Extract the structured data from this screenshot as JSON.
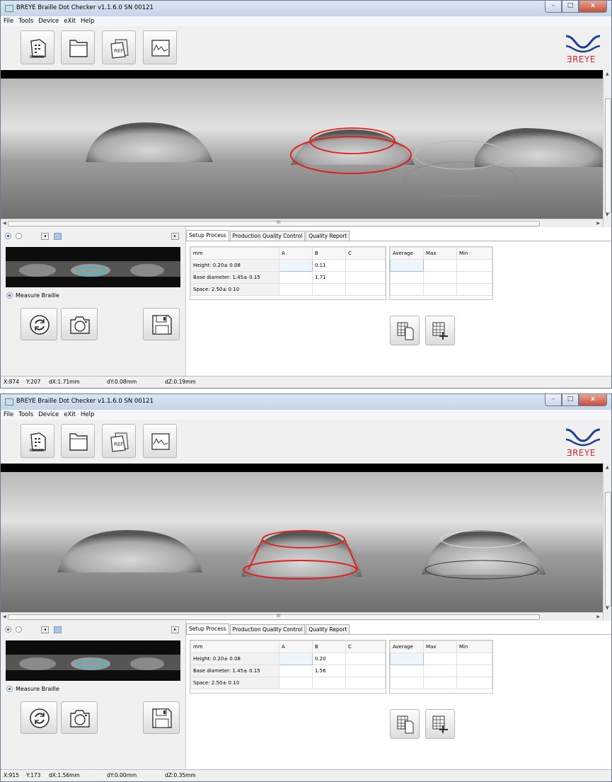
{
  "windows": [
    {
      "title": "BREYE Braille Dot Checker v1.1.6.0 SN 00121",
      "window_controls": {
        "minimize": "–",
        "maximize": "□",
        "close": "x"
      },
      "menu": [
        "File",
        "Tools",
        "Device",
        "eXit",
        "Help"
      ],
      "logo_text": "BREYE",
      "measure_label": "Measure Braille",
      "tabs": [
        "Setup Process",
        "Production Quality Control",
        "Quality Report"
      ],
      "active_tab": "Setup Process",
      "table_headers": [
        "mm",
        "A",
        "B",
        "C"
      ],
      "rows": [
        {
          "label": "Height: 0.20± 0.08",
          "a": "",
          "b": "0.11",
          "c": ""
        },
        {
          "label": "Base diameter: 1.45± 0.15",
          "a": "",
          "b": "1.71",
          "c": ""
        },
        {
          "label": "Space: 2.50± 0.10",
          "a": "",
          "b": "",
          "c": ""
        }
      ],
      "stats_headers": [
        "Average",
        "Max",
        "Min"
      ],
      "status": {
        "x": "X:874",
        "y": "Y:207",
        "dx": "dX:1.71mm",
        "dy": "dY:0.08mm",
        "dz": "dZ:0.19mm"
      },
      "hscroll_mark": "III"
    },
    {
      "title": "BREYE Braille Dot Checker v1.1.6.0 SN 00121",
      "window_controls": {
        "minimize": "–",
        "maximize": "□",
        "close": "x"
      },
      "menu": [
        "File",
        "Tools",
        "Device",
        "eXit",
        "Help"
      ],
      "logo_text": "BREYE",
      "measure_label": "Measure Braille",
      "tabs": [
        "Setup Process",
        "Production Quality Control",
        "Quality Report"
      ],
      "active_tab": "Setup Process",
      "table_headers": [
        "mm",
        "A",
        "B",
        "C"
      ],
      "rows": [
        {
          "label": "Height: 0.20± 0.08",
          "a": "",
          "b": "0.20",
          "c": ""
        },
        {
          "label": "Base diameter: 1.45± 0.15",
          "a": "",
          "b": "1.56",
          "c": ""
        },
        {
          "label": "Space: 2.50± 0.10",
          "a": "",
          "b": "",
          "c": ""
        }
      ],
      "stats_headers": [
        "Average",
        "Max",
        "Min"
      ],
      "status": {
        "x": "X:915",
        "y": "Y:173",
        "dx": "dX:1.56mm",
        "dy": "dY:0.00mm",
        "dz": "dZ:0.35mm"
      },
      "hscroll_mark": "III"
    }
  ],
  "colors": {
    "measurement_overlay": "#e0201c",
    "thumbnail_marker": "#19c8d6",
    "logo_blue": "#1c3f8f",
    "logo_red": "#d8262d"
  }
}
